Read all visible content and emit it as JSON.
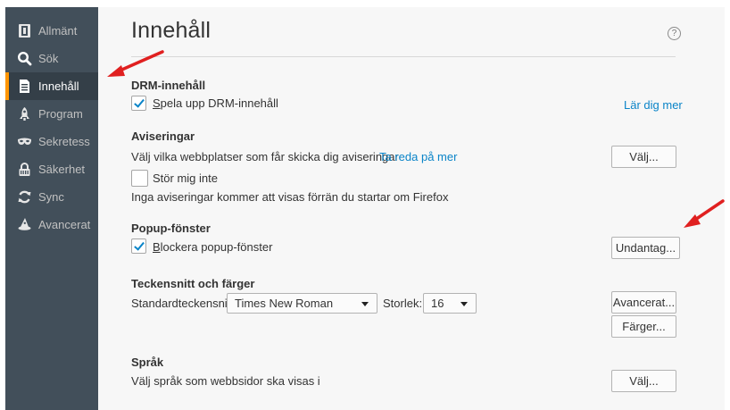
{
  "sidebar": {
    "items": [
      {
        "label": "Allmänt",
        "icon": "general-icon"
      },
      {
        "label": "Sök",
        "icon": "search-icon"
      },
      {
        "label": "Innehåll",
        "icon": "content-icon",
        "selected": true
      },
      {
        "label": "Program",
        "icon": "rocket-icon"
      },
      {
        "label": "Sekretess",
        "icon": "mask-icon"
      },
      {
        "label": "Säkerhet",
        "icon": "lock-icon"
      },
      {
        "label": "Sync",
        "icon": "sync-icon"
      },
      {
        "label": "Avancerat",
        "icon": "wizard-hat-icon"
      }
    ]
  },
  "header": {
    "title": "Innehåll",
    "help_glyph": "?"
  },
  "drm": {
    "heading": "DRM-innehåll",
    "checkbox_label": "Spela upp DRM-innehåll",
    "checkbox_accesskey": "S",
    "checkbox_label_rest": "pela upp DRM-innehåll",
    "checked": true,
    "learn_more": "Lär dig mer"
  },
  "notifications": {
    "heading": "Aviseringar",
    "description": "Välj vilka webbplatser som får skicka dig aviseringar",
    "link": "Ta reda på mer",
    "choose_button": "Välj...",
    "dnd_label": "Stör mig inte",
    "dnd_checked": false,
    "info": "Inga aviseringar kommer att visas förrän du startar om Firefox"
  },
  "popups": {
    "heading": "Popup-fönster",
    "checkbox_label": "Blockera popup-fönster",
    "checkbox_accesskey": "B",
    "checkbox_label_rest": "lockera popup-fönster",
    "checked": true,
    "exceptions_button": "Undantag..."
  },
  "fonts": {
    "heading": "Teckensnitt och färger",
    "default_font_label": "Standardteckensnitt:",
    "default_font_value": "Times New Roman",
    "size_label": "Storlek:",
    "size_value": "16",
    "advanced_button": "Avancerat...",
    "colors_button": "Färger..."
  },
  "language": {
    "heading": "Språk",
    "description": "Välj språk som webbsidor ska visas i",
    "choose_button": "Välj..."
  },
  "colors": {
    "sidebar_bg": "#424f5a",
    "sidebar_selected_bg": "#343f48",
    "selected_marker": "#ff9500",
    "link": "#0a84c8",
    "annotation_arrow": "#e02020"
  }
}
